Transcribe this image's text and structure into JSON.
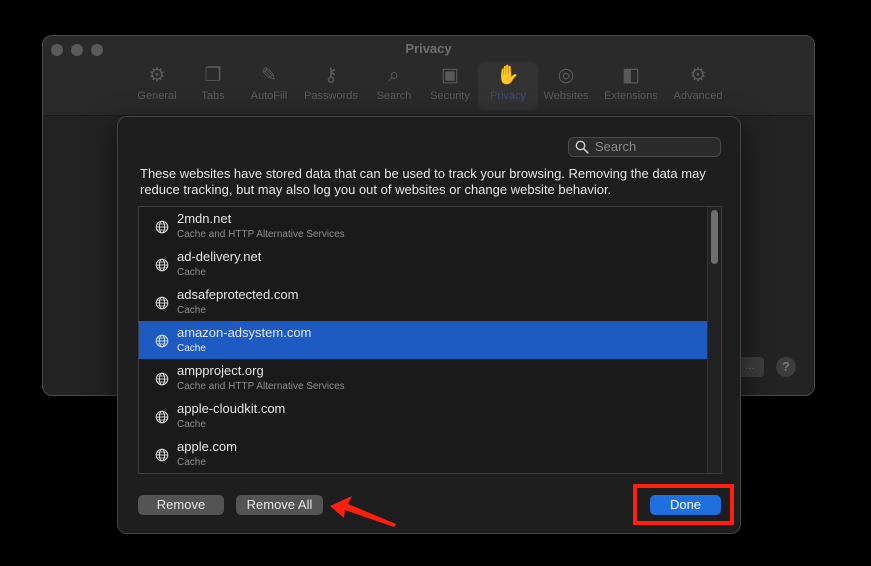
{
  "background_window": {
    "title": "Privacy",
    "toolbar": [
      {
        "label": "General",
        "icon": "gear-icon"
      },
      {
        "label": "Tabs",
        "icon": "tabs-icon"
      },
      {
        "label": "AutoFill",
        "icon": "pencil-icon"
      },
      {
        "label": "Passwords",
        "icon": "key-icon"
      },
      {
        "label": "Search",
        "icon": "search-icon"
      },
      {
        "label": "Security",
        "icon": "lock-icon"
      },
      {
        "label": "Privacy",
        "icon": "hand-icon",
        "active": true
      },
      {
        "label": "Websites",
        "icon": "globe-icon"
      },
      {
        "label": "Extensions",
        "icon": "puzzle-icon"
      },
      {
        "label": "Advanced",
        "icon": "gears-icon"
      }
    ],
    "details_button_label": "...",
    "help_label": "?"
  },
  "sheet": {
    "search": {
      "placeholder": "Search"
    },
    "description": "These websites have stored data that can be used to track your browsing. Removing the data may reduce tracking, but may also log you out of websites or change website behavior.",
    "websites": [
      {
        "site": "2mdn.net",
        "kind": "Cache and HTTP Alternative Services"
      },
      {
        "site": "ad-delivery.net",
        "kind": "Cache"
      },
      {
        "site": "adsafeprotected.com",
        "kind": "Cache"
      },
      {
        "site": "amazon-adsystem.com",
        "kind": "Cache",
        "selected": true
      },
      {
        "site": "ampproject.org",
        "kind": "Cache and HTTP Alternative Services"
      },
      {
        "site": "apple-cloudkit.com",
        "kind": "Cache"
      },
      {
        "site": "apple.com",
        "kind": "Cache"
      }
    ],
    "buttons": {
      "remove": "Remove",
      "remove_all": "Remove All",
      "done": "Done"
    }
  },
  "colors": {
    "selection": "#1d5bc2",
    "done_button": "#1f6fe0",
    "annotation": "#ff1f0f"
  }
}
